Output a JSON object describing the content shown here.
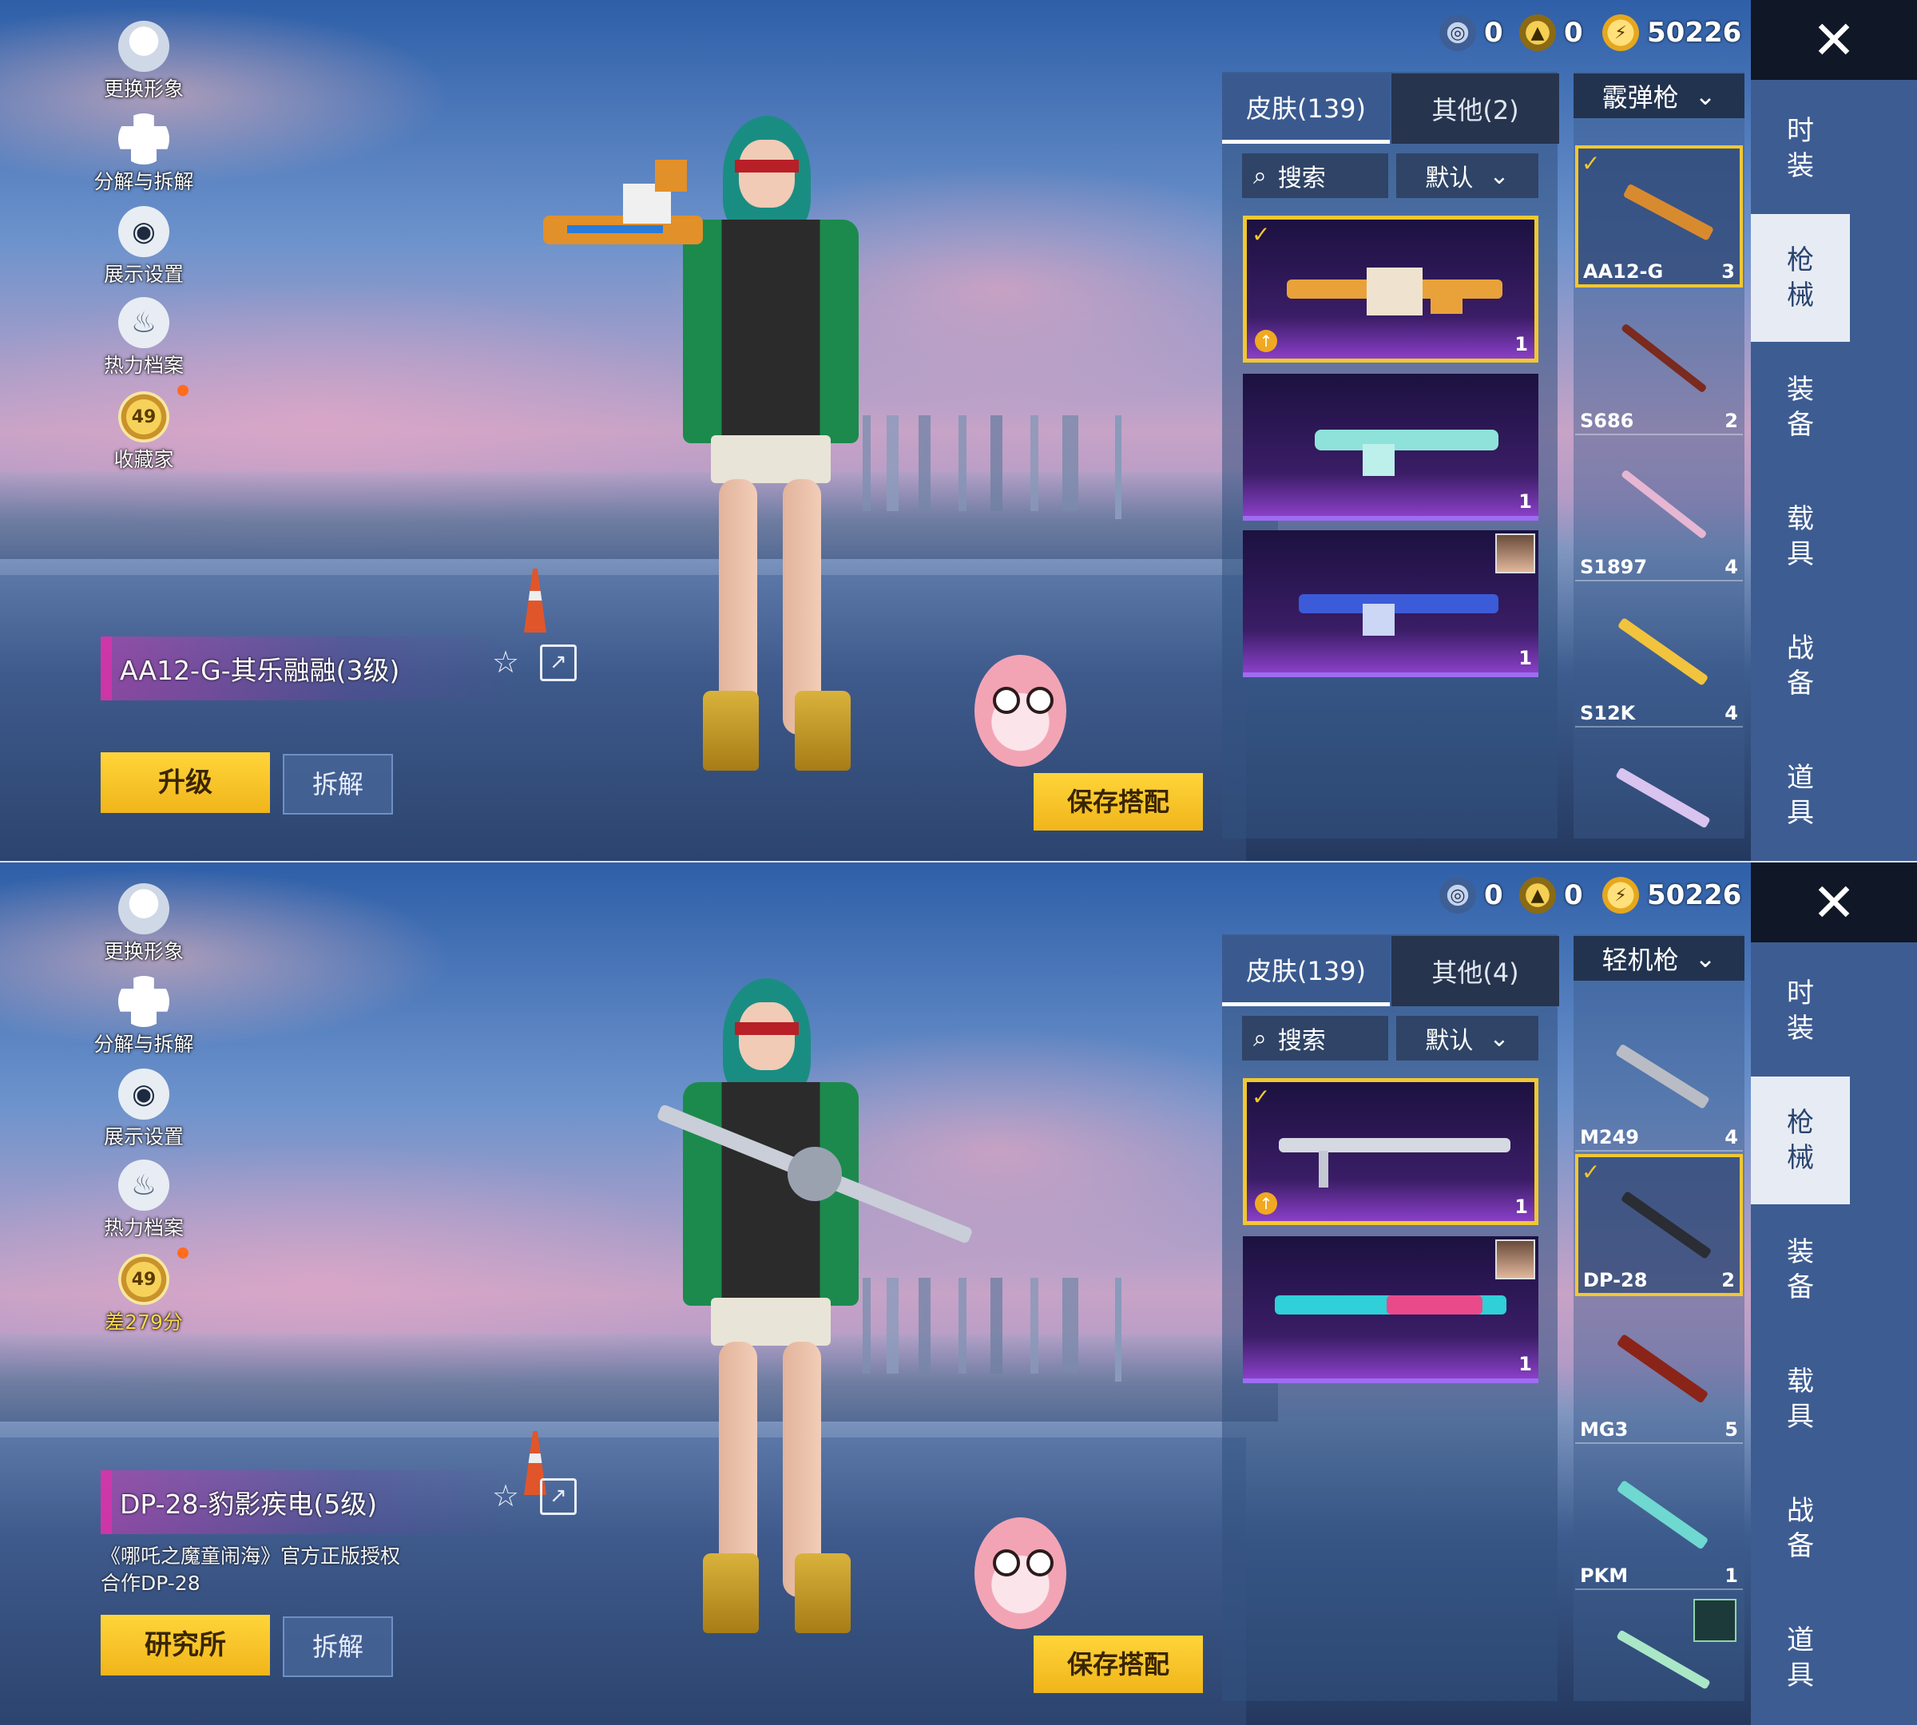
{
  "left_menu": [
    {
      "icon": "person-icon",
      "label": "更换形象"
    },
    {
      "icon": "puzzle-icon",
      "label": "分解与拆解"
    },
    {
      "icon": "eye-icon",
      "label": "展示设置"
    },
    {
      "icon": "fire-icon",
      "label": "热力档案"
    }
  ],
  "currency": [
    {
      "icon": "blue-coin-icon",
      "value": "0"
    },
    {
      "icon": "gold-coin-icon",
      "value": "0"
    },
    {
      "icon": "bolt-coin-icon",
      "value": "50226"
    }
  ],
  "nav": [
    "时\n装",
    "枪\n械",
    "装\n备",
    "载\n具",
    "战\n备",
    "道\n具"
  ],
  "panelA": {
    "collector_badge": "49",
    "collector_label": "收藏家",
    "item_name": "AA12-G-其乐融融(3级)",
    "primary_button": "升级",
    "dismantle_button": "拆解",
    "save_button": "保存搭配",
    "tab_skins": "皮肤(139)",
    "tab_other": "其他(2)",
    "search_label": "搜索",
    "sort_label": "默认",
    "category": "霰弹枪",
    "skins": [
      {
        "count": "1"
      },
      {
        "count": "1"
      },
      {
        "count": "1"
      }
    ],
    "guns": [
      {
        "name": "AA12-G",
        "count": "3"
      },
      {
        "name": "S686",
        "count": "2"
      },
      {
        "name": "S1897",
        "count": "4"
      },
      {
        "name": "S12K",
        "count": "4"
      },
      {
        "name": "",
        "count": ""
      }
    ]
  },
  "panelB": {
    "collector_badge": "49",
    "collector_label": "差279分",
    "item_name": "DP-28-豹影疾电(5级)",
    "auth_text": "《哪吒之魔童闹海》官方正版授权合作DP-28",
    "primary_button": "研究所",
    "dismantle_button": "拆解",
    "save_button": "保存搭配",
    "tab_skins": "皮肤(139)",
    "tab_other": "其他(4)",
    "search_label": "搜索",
    "sort_label": "默认",
    "category": "轻机枪",
    "skins": [
      {
        "count": "1"
      },
      {
        "count": "1"
      }
    ],
    "guns": [
      {
        "name": "M249",
        "count": "4"
      },
      {
        "name": "DP-28",
        "count": "2"
      },
      {
        "name": "MG3",
        "count": "5"
      },
      {
        "name": "PKM",
        "count": "1"
      },
      {
        "name": "",
        "count": ""
      }
    ]
  },
  "colors": {
    "accent": "#f1c830",
    "panel": "#3d5c92",
    "card_purple": "#8a3fc7"
  }
}
